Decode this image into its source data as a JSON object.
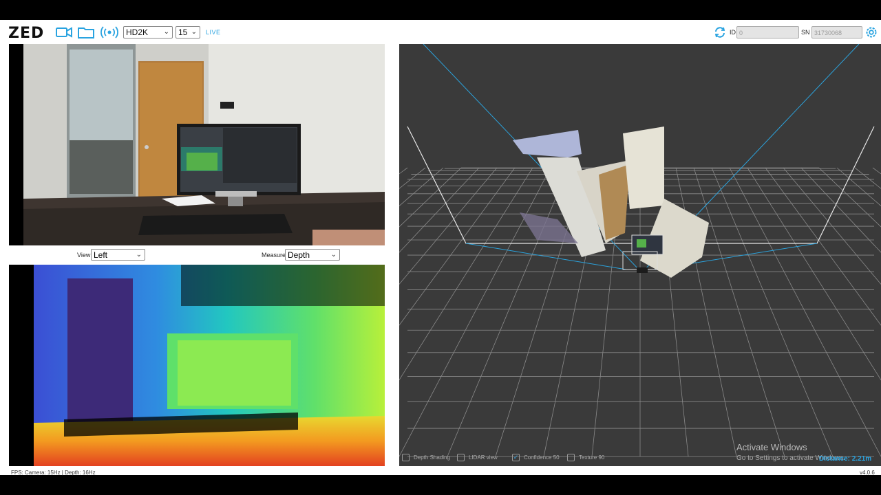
{
  "toolbar": {
    "logo": "ZED",
    "resolution": "HD2K",
    "fps": "15",
    "live_label": "LIVE",
    "id_label": "ID",
    "id_value": "0",
    "sn_label": "SN",
    "sn_value": "31730068"
  },
  "left": {
    "view_label": "View",
    "view_value": "Left",
    "measure_label": "Measure",
    "measure_value": "Depth"
  },
  "viewer3d": {
    "options": [
      {
        "label": "Depth Shading",
        "checked": false
      },
      {
        "label": "LIDAR view",
        "checked": false
      },
      {
        "label": "Confidence 50",
        "checked": true
      },
      {
        "label": "Texture 90",
        "checked": false
      }
    ],
    "distance": "Distance: 2.21m",
    "watermark_title": "Activate Windows",
    "watermark_sub": "Go to Settings to activate Windows."
  },
  "status": {
    "fps_text": "FPS: Camera: 15Hz | Depth: 16Hz",
    "version": "v4.0.6"
  },
  "colors": {
    "accent": "#29a3e0",
    "viewer_bg": "#3a3a3a"
  }
}
